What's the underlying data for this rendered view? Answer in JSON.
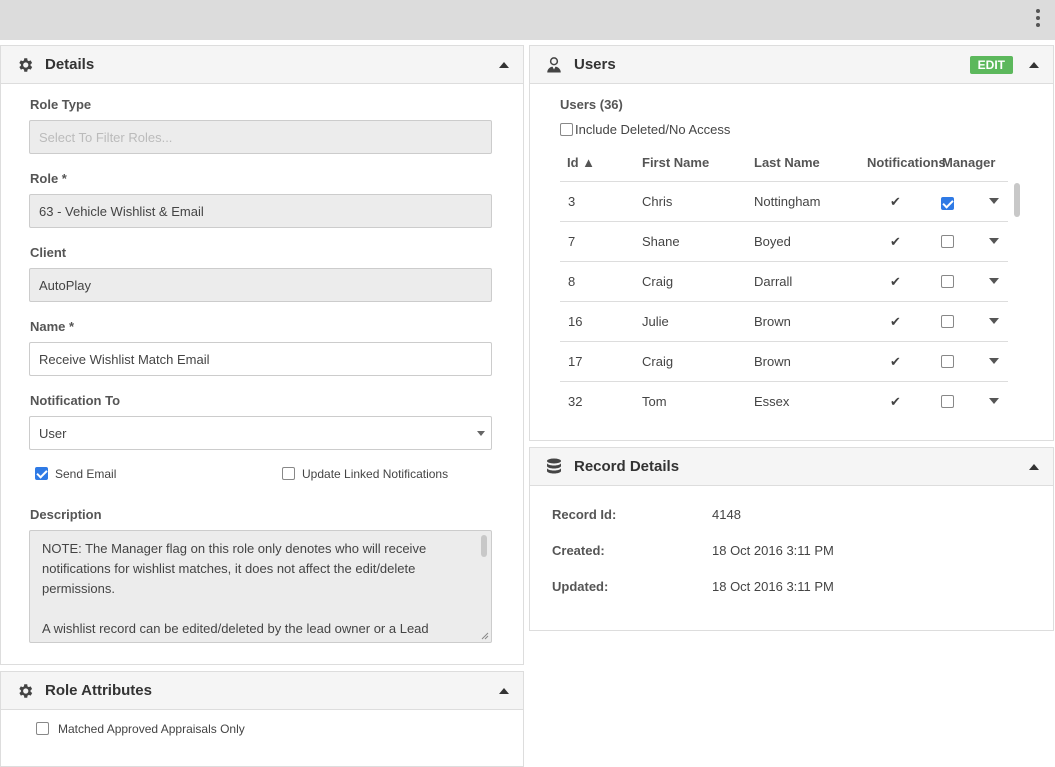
{
  "details": {
    "title": "Details",
    "role_type": {
      "label": "Role Type",
      "placeholder": "Select To Filter Roles..."
    },
    "role": {
      "label": "Role *",
      "value": "63 - Vehicle Wishlist & Email"
    },
    "client": {
      "label": "Client",
      "value": "AutoPlay"
    },
    "name": {
      "label": "Name *",
      "value": "Receive Wishlist Match Email"
    },
    "notification_to": {
      "label": "Notification To",
      "value": "User"
    },
    "send_email": {
      "label": "Send Email",
      "checked": true
    },
    "update_linked": {
      "label": "Update Linked Notifications",
      "checked": false
    },
    "description": {
      "label": "Description",
      "para1": "NOTE: The Manager flag on this role only denotes who will receive notifications for wishlist matches, it does not affect the edit/delete permissions.",
      "para2": "A wishlist record can be edited/deleted by the lead owner or a Lead Manager according to the role."
    }
  },
  "role_attributes": {
    "title": "Role Attributes",
    "matched_approved": {
      "label": "Matched Approved Appraisals Only",
      "checked": false
    }
  },
  "users": {
    "title": "Users",
    "edit_label": "EDIT",
    "count_label": "Users (36)",
    "include_deleted": {
      "label": "Include Deleted/No Access",
      "checked": false
    },
    "columns": {
      "id": "Id ▲",
      "first": "First Name",
      "last": "Last Name",
      "notifications": "Notifications",
      "manager": "Manager"
    },
    "rows": [
      {
        "id": "3",
        "first": "Chris",
        "last": "Nottingham",
        "notifications": "✔",
        "manager": true
      },
      {
        "id": "7",
        "first": "Shane",
        "last": "Boyed",
        "notifications": "✔",
        "manager": false
      },
      {
        "id": "8",
        "first": "Craig",
        "last": "Darrall",
        "notifications": "✔",
        "manager": false
      },
      {
        "id": "16",
        "first": "Julie",
        "last": "Brown",
        "notifications": "✔",
        "manager": false
      },
      {
        "id": "17",
        "first": "Craig",
        "last": "Brown",
        "notifications": "✔",
        "manager": false
      },
      {
        "id": "32",
        "first": "Tom",
        "last": "Essex",
        "notifications": "✔",
        "manager": false
      }
    ]
  },
  "record_details": {
    "title": "Record Details",
    "record_id": {
      "label": "Record Id:",
      "value": "4148"
    },
    "created": {
      "label": "Created:",
      "value": "18 Oct 2016 3:11 PM"
    },
    "updated": {
      "label": "Updated:",
      "value": "18 Oct 2016 3:11 PM"
    }
  },
  "colors": {
    "accent": "#2f7ae5",
    "edit_button": "#5cb85c",
    "header_bg": "#f5f5f5"
  },
  "icons": {
    "details": "gear-icon",
    "users": "user-icon",
    "record_details": "database-icon",
    "role_attributes": "gear-icon"
  }
}
